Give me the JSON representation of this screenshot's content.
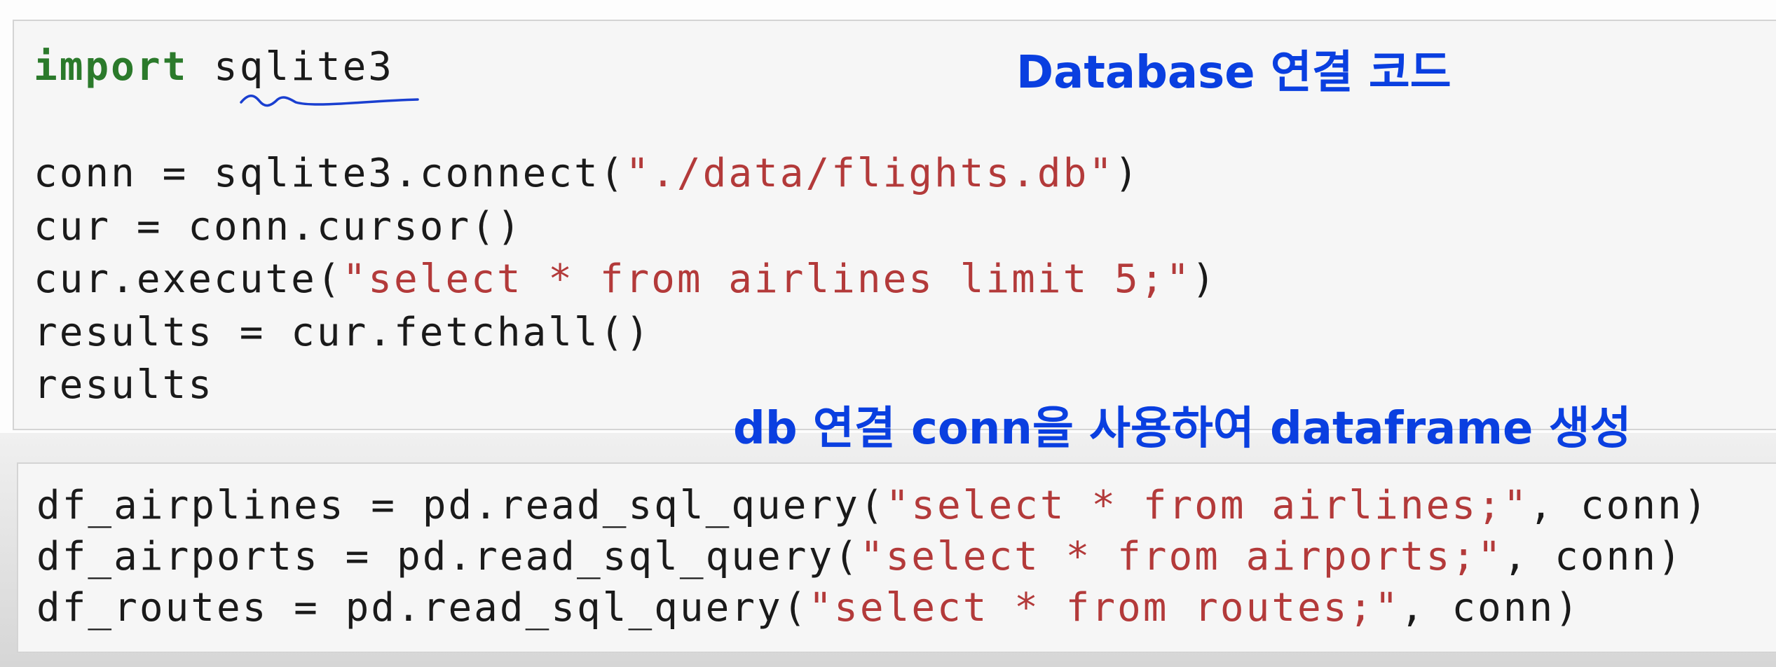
{
  "cell1": {
    "line1": {
      "keyword": "import",
      "module": " sqlite3"
    },
    "line2": {
      "prefix": "conn = sqlite3.connect(",
      "string": "\"./data/flights.db\"",
      "suffix": ")"
    },
    "line3": {
      "text": "cur = conn.cursor()"
    },
    "line4": {
      "prefix": "cur.execute(",
      "string": "\"select * from airlines limit 5;\"",
      "suffix": ")"
    },
    "line5": {
      "text": "results = cur.fetchall()"
    },
    "line6": {
      "text": "results"
    }
  },
  "cell2": {
    "line1": {
      "prefix": "df_airplines = pd.read_sql_query(",
      "string": "\"select * from airlines;\"",
      "suffix": ", conn)"
    },
    "line2": {
      "prefix": "df_airports = pd.read_sql_query(",
      "string": "\"select * from airports;\"",
      "suffix": ", conn)"
    },
    "line3": {
      "prefix": "df_routes = pd.read_sql_query(",
      "string": "\"select * from routes;\"",
      "suffix": ", conn)"
    }
  },
  "annotations": {
    "db_connection_code": "Database 연결 코드",
    "dataframe_creation": "db 연결 conn을 사용하여 dataframe 생성"
  },
  "colors": {
    "annotation": "#0a3fe0",
    "keyword": "#2b7a2b",
    "string": "#b33a3a",
    "underline": "#1a3fd0"
  }
}
